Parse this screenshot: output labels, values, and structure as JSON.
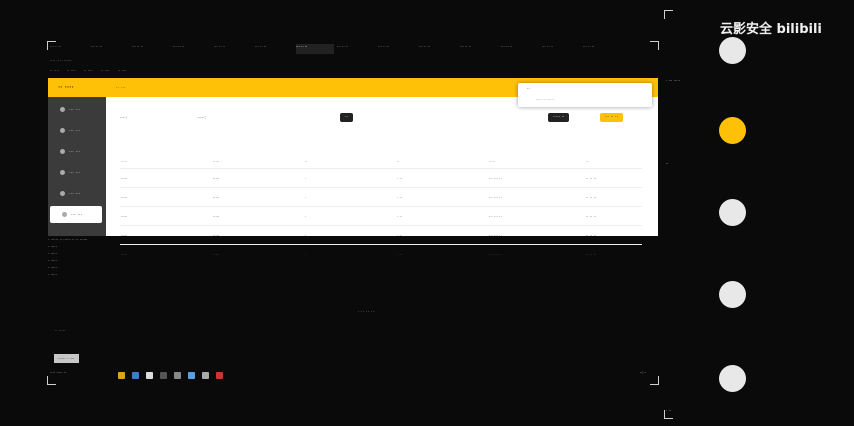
{
  "browser": {
    "tabs": [
      "··· ·· ··",
      "··· ·· ··",
      "··· ·· ··",
      "··· ·· ··",
      "··· ·· ··",
      "··· ·· ··",
      "··· ·· ··",
      "··· ·· ··",
      "··· ·· ··",
      "··· ·· ··",
      "··· ·· ··",
      "··· ·· ··",
      "··· ·· ··",
      "··· ·· ··"
    ],
    "address": "···· ·· ·· ······",
    "bookmarks": [
      "·· ····",
      "·· ····",
      "·· ····",
      "·· ····",
      "·· ····"
    ]
  },
  "app": {
    "logo": "·· ····",
    "breadcrumb": "·· ···",
    "sidebar": [
      "··· ···",
      "··· ···",
      "··· ···",
      "··· ···",
      "··· ···",
      "··· ···"
    ],
    "filters": [
      "····:",
      "·····:"
    ],
    "search_button": "··",
    "action_buttons": [
      "·····  ··",
      "··· ·· ··"
    ],
    "table_headers": [
      "·····",
      "·····",
      "··",
      "··",
      "·····",
      "··"
    ],
    "rows": [
      [
        "·····",
        "·····",
        "·",
        "· ··",
        "··· ··· ··",
        "··  ··  ··"
      ],
      [
        "·····",
        "·····",
        "·",
        "· ··",
        "··· ··· ··",
        "··  ··  ··"
      ],
      [
        "·····",
        "·····",
        "·",
        "· ··",
        "··· ··· ··",
        "··  ··  ··"
      ],
      [
        "·····",
        "·····",
        "·",
        "· ··",
        "··· ··· ··",
        "··  ··  ··"
      ],
      [
        "·····",
        "·····",
        "·",
        "· ··",
        "··· ··· ··",
        "··  ··  ··"
      ]
    ],
    "popup_title": "··",
    "popup_detail": "······  ·· ······"
  },
  "console_lines": [
    "· ······ ·· ······ ·· ·· ······",
    "· ·····",
    "· ·····",
    "· ·····",
    "· ·····",
    "· ·····"
  ],
  "center_text": "· · · · · · ·",
  "input_hint": "·· ·····",
  "taskbar": {
    "button": "······ · ····",
    "title": "···· ····· ··",
    "clock": "··:··"
  },
  "right": {
    "watermark": "云影安全 bilibili",
    "labels": [
      "· ··· ·····",
      "··",
      "· ··"
    ]
  },
  "colors": {
    "accent": "#ffc107",
    "background": "#0a0a0a",
    "sidebar": "#3b3b3b"
  }
}
